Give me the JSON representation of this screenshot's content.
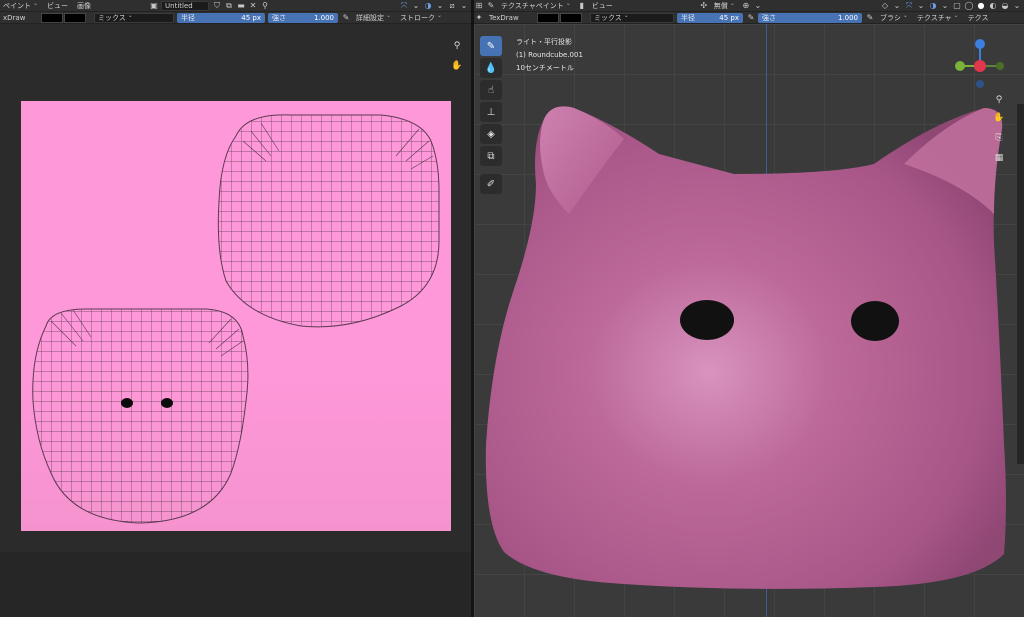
{
  "left_header_top": {
    "paint_menu": "ペイント",
    "view_menu": "ビュー",
    "image_menu": "画像",
    "image_name": "Untitled"
  },
  "left_header_bottom": {
    "brush_name": "xDraw",
    "blend_mode": "ミックス",
    "radius_label": "半径",
    "radius_value": "45 px",
    "strength_label": "強さ",
    "strength_value": "1.000",
    "advanced_label": "詳細設定",
    "stroke_label": "ストローク"
  },
  "right_header_top": {
    "mode": "テクスチャペイント",
    "view_menu": "ビュー",
    "orientation": "無償"
  },
  "right_header_bottom": {
    "brush_name": "TexDraw",
    "blend_mode": "ミックス",
    "radius_label": "半径",
    "radius_value": "45 px",
    "strength_label": "強さ",
    "strength_value": "1.000",
    "brush_menu": "ブラシ",
    "texture_menu": "テクスチャ",
    "texture_menu_2": "テクス"
  },
  "viewport_info": {
    "line1": "ライト・平行投影",
    "line2": "(1) Roundcube.001",
    "line3": "10センチメートル"
  },
  "colors": {
    "accent": "#4772b3",
    "canvas_pink": "#ff98d8",
    "mesh_pink": "#c06696",
    "gizmo_x": "#e0374d",
    "gizmo_y": "#7ab23a",
    "gizmo_z": "#3b7fe0"
  },
  "icons": {
    "zoom": "magnifier-icon",
    "pan": "hand-icon",
    "camera": "camera-icon",
    "grid": "grid-icon",
    "draw": "brush-icon",
    "soften": "drop-icon",
    "smear": "smear-icon",
    "clone": "stamp-icon",
    "fill": "fill-icon",
    "mask": "mask-icon",
    "annotate": "annotate-icon"
  }
}
